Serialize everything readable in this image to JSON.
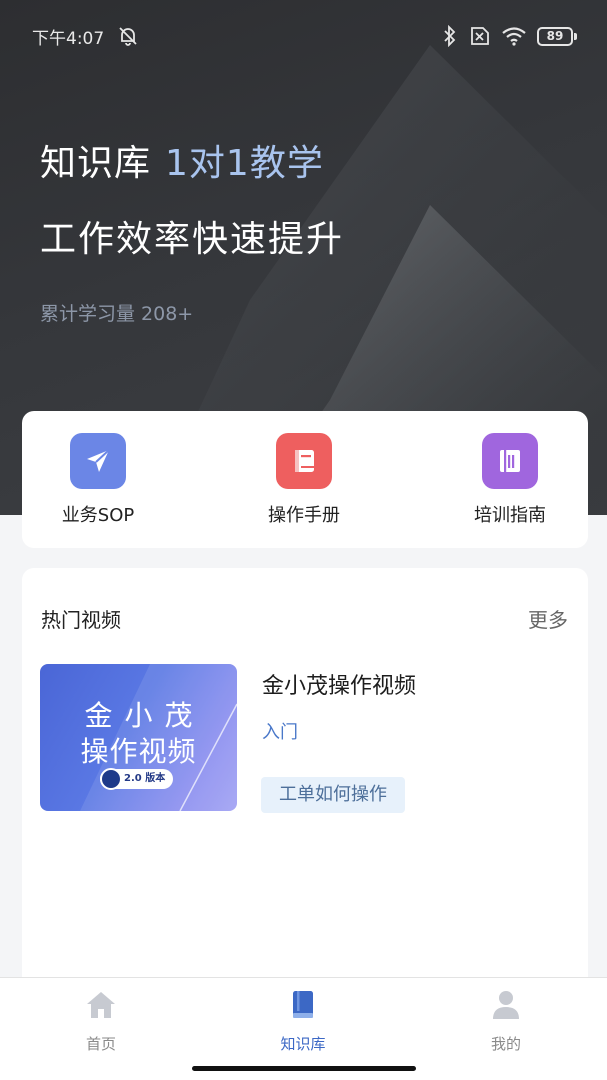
{
  "status_bar": {
    "time": "下午4:07",
    "battery": "89"
  },
  "hero": {
    "title": "知识库",
    "title_accent": "1对1教学",
    "subtitle": "工作效率快速提升",
    "stat": "累计学习量 208+"
  },
  "quick_access": [
    {
      "label": "业务SOP",
      "icon": "send-icon",
      "color": "#6b86e6"
    },
    {
      "label": "操作手册",
      "icon": "book-icon",
      "color": "#ee5f5f"
    },
    {
      "label": "培训指南",
      "icon": "notebook-icon",
      "color": "#a066de"
    }
  ],
  "hot_videos": {
    "title": "热门视频",
    "more": "更多",
    "items": [
      {
        "thumb_line1": "金小茂",
        "thumb_line2": "操作视频",
        "thumb_badge": "2.0 版本",
        "title": "金小茂操作视频",
        "level": "入门",
        "tag": "工单如何操作"
      }
    ]
  },
  "tabbar": {
    "tabs": [
      {
        "label": "首页",
        "icon": "home-icon",
        "active": false
      },
      {
        "label": "知识库",
        "icon": "book-icon",
        "active": true
      },
      {
        "label": "我的",
        "icon": "user-icon",
        "active": false
      }
    ],
    "active_color": "#3c68c5",
    "inactive_color": "#8a8a8a"
  }
}
